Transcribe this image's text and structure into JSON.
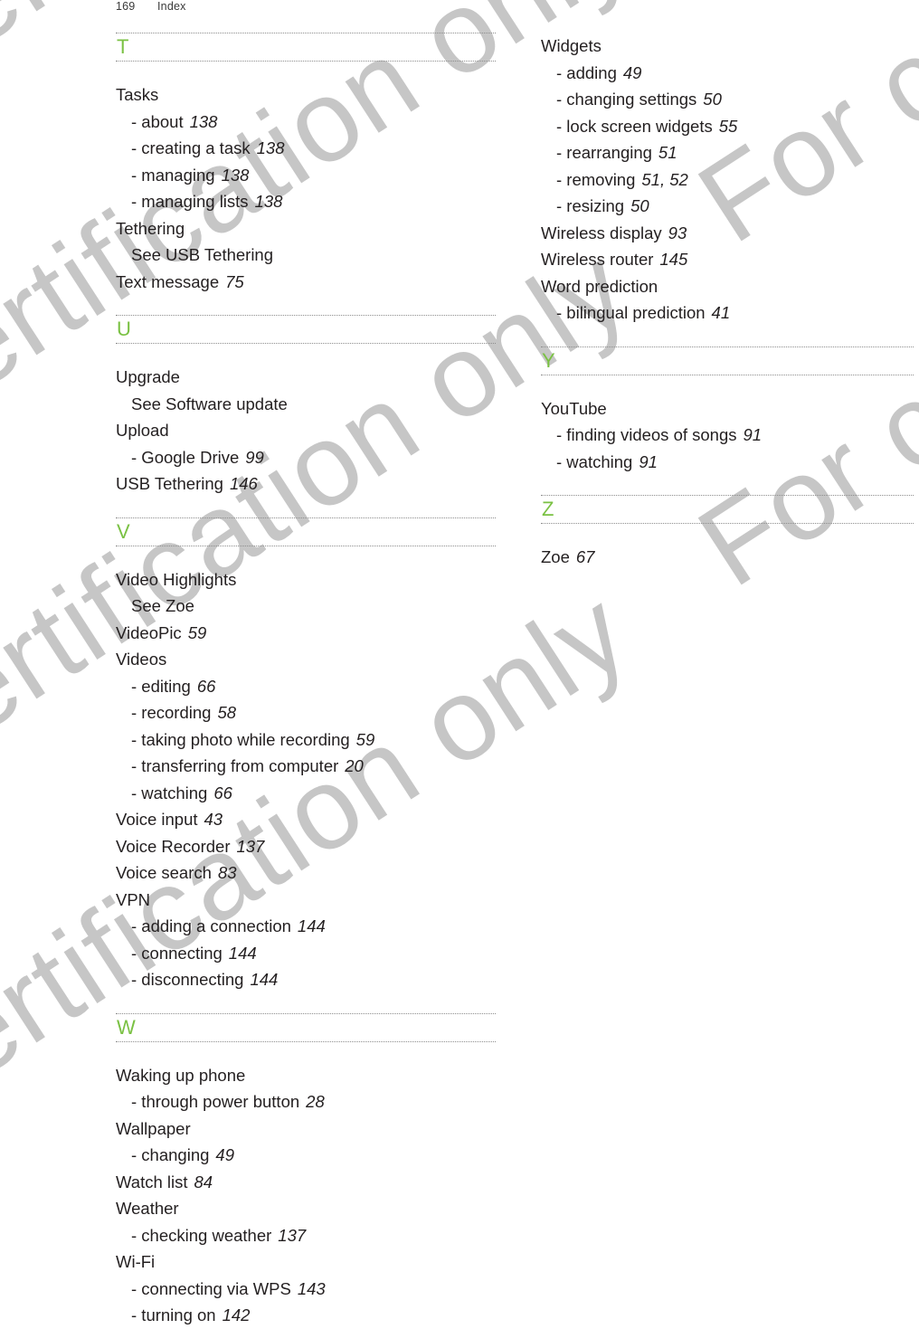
{
  "header": {
    "folio": "169",
    "title": "Index"
  },
  "watermark": {
    "text": "For certification only",
    "color": "#c6c6c6"
  },
  "theme": {
    "letter_color": "#7ac143",
    "text_color": "#231f20",
    "rule_color": "#8d8d8d"
  },
  "columns": [
    {
      "name": "left",
      "sections": [
        {
          "letter": "T",
          "entries": [
            {
              "label": "Tasks",
              "num": "",
              "type": "main"
            },
            {
              "label": "- about",
              "num": "138",
              "type": "sub"
            },
            {
              "label": "- creating a task",
              "num": "138",
              "type": "sub"
            },
            {
              "label": "- managing",
              "num": "138",
              "type": "sub"
            },
            {
              "label": "- managing lists",
              "num": "138",
              "type": "sub"
            },
            {
              "label": "Tethering",
              "num": "",
              "type": "main"
            },
            {
              "label": "See USB Tethering",
              "num": "",
              "type": "seeref"
            },
            {
              "label": "Text message",
              "num": "75",
              "type": "main"
            }
          ]
        },
        {
          "letter": "U",
          "entries": [
            {
              "label": "Upgrade",
              "num": "",
              "type": "main"
            },
            {
              "label": "See Software update",
              "num": "",
              "type": "seeref"
            },
            {
              "label": "Upload",
              "num": "",
              "type": "main"
            },
            {
              "label": "- Google Drive",
              "num": "99",
              "type": "sub"
            },
            {
              "label": "USB Tethering",
              "num": "146",
              "type": "main"
            }
          ]
        },
        {
          "letter": "V",
          "entries": [
            {
              "label": "Video Highlights",
              "num": "",
              "type": "main"
            },
            {
              "label": "See Zoe",
              "num": "",
              "type": "seeref"
            },
            {
              "label": "VideoPic",
              "num": "59",
              "type": "main"
            },
            {
              "label": "Videos",
              "num": "",
              "type": "main"
            },
            {
              "label": "- editing",
              "num": "66",
              "type": "sub"
            },
            {
              "label": "- recording",
              "num": "58",
              "type": "sub"
            },
            {
              "label": "- taking photo while recording",
              "num": "59",
              "type": "sub"
            },
            {
              "label": "- transferring from computer",
              "num": "20",
              "type": "sub"
            },
            {
              "label": "- watching",
              "num": "66",
              "type": "sub"
            },
            {
              "label": "Voice input",
              "num": "43",
              "type": "main"
            },
            {
              "label": "Voice Recorder",
              "num": "137",
              "type": "main"
            },
            {
              "label": "Voice search",
              "num": "83",
              "type": "main"
            },
            {
              "label": "VPN",
              "num": "",
              "type": "main"
            },
            {
              "label": "- adding a connection",
              "num": "144",
              "type": "sub"
            },
            {
              "label": "- connecting",
              "num": "144",
              "type": "sub"
            },
            {
              "label": "- disconnecting",
              "num": "144",
              "type": "sub"
            }
          ]
        },
        {
          "letter": "W",
          "entries": [
            {
              "label": "Waking up phone",
              "num": "",
              "type": "main"
            },
            {
              "label": "- through power button",
              "num": "28",
              "type": "sub"
            },
            {
              "label": "Wallpaper",
              "num": "",
              "type": "main"
            },
            {
              "label": "- changing",
              "num": "49",
              "type": "sub"
            },
            {
              "label": "Watch list",
              "num": "84",
              "type": "main"
            },
            {
              "label": "Weather",
              "num": "",
              "type": "main"
            },
            {
              "label": "- checking weather",
              "num": "137",
              "type": "sub"
            },
            {
              "label": "Wi-Fi",
              "num": "",
              "type": "main"
            },
            {
              "label": "- connecting via WPS",
              "num": "143",
              "type": "sub"
            },
            {
              "label": "- turning on",
              "num": "142",
              "type": "sub"
            }
          ]
        }
      ]
    },
    {
      "name": "right",
      "sections": [
        {
          "letter": "",
          "entries": [
            {
              "label": "Widgets",
              "num": "",
              "type": "main"
            },
            {
              "label": "- adding",
              "num": "49",
              "type": "sub"
            },
            {
              "label": "- changing settings",
              "num": "50",
              "type": "sub"
            },
            {
              "label": "- lock screen widgets",
              "num": "55",
              "type": "sub"
            },
            {
              "label": "- rearranging",
              "num": "51",
              "type": "sub"
            },
            {
              "label": "- removing",
              "num": "51, 52",
              "type": "sub"
            },
            {
              "label": "- resizing",
              "num": "50",
              "type": "sub"
            },
            {
              "label": "Wireless display",
              "num": "93",
              "type": "main"
            },
            {
              "label": "Wireless router",
              "num": "145",
              "type": "main"
            },
            {
              "label": "Word prediction",
              "num": "",
              "type": "main"
            },
            {
              "label": "- bilingual prediction",
              "num": "41",
              "type": "sub"
            }
          ]
        },
        {
          "letter": "Y",
          "entries": [
            {
              "label": "YouTube",
              "num": "",
              "type": "main"
            },
            {
              "label": "- finding videos of songs",
              "num": "91",
              "type": "sub"
            },
            {
              "label": "- watching",
              "num": "91",
              "type": "sub"
            }
          ]
        },
        {
          "letter": "Z",
          "entries": [
            {
              "label": "Zoe",
              "num": "67",
              "type": "main"
            }
          ]
        }
      ]
    }
  ]
}
